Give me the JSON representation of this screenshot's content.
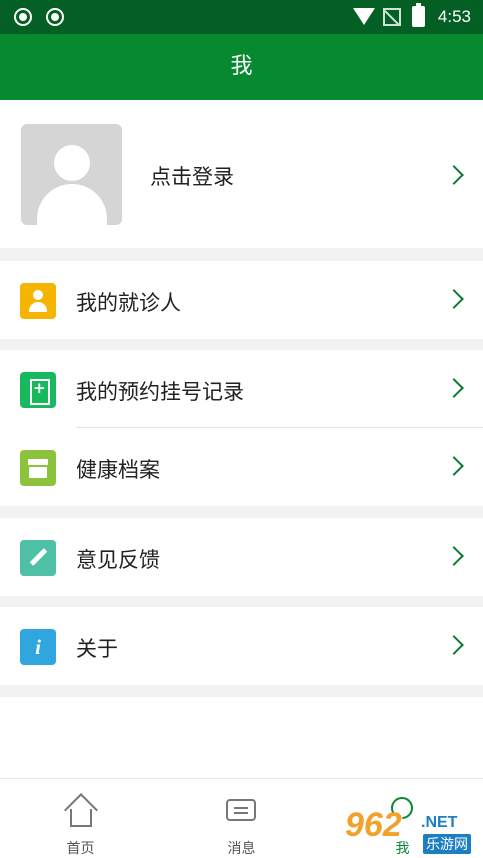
{
  "status_bar": {
    "time": "4:53"
  },
  "header": {
    "title": "我"
  },
  "profile": {
    "login_label": "点击登录"
  },
  "menu": {
    "items": [
      {
        "label": "我的就诊人",
        "icon": "user-icon"
      },
      {
        "label": "我的预约挂号记录",
        "icon": "appointment-record-icon"
      },
      {
        "label": "健康档案",
        "icon": "health-file-icon"
      },
      {
        "label": "意见反馈",
        "icon": "edit-pencil-icon"
      },
      {
        "label": "关于",
        "icon": "info-icon",
        "glyph": "i"
      }
    ]
  },
  "tabs": [
    {
      "label": "首页",
      "icon": "home-icon"
    },
    {
      "label": "消息",
      "icon": "message-icon"
    },
    {
      "label": "我",
      "icon": "person-icon",
      "active": true
    }
  ],
  "watermark": {
    "logo": "962",
    "suffix": ".NET",
    "text": "乐游网"
  },
  "colors": {
    "status_bar": "#045f24",
    "header": "#06892f",
    "accent": "#0a7a33"
  }
}
